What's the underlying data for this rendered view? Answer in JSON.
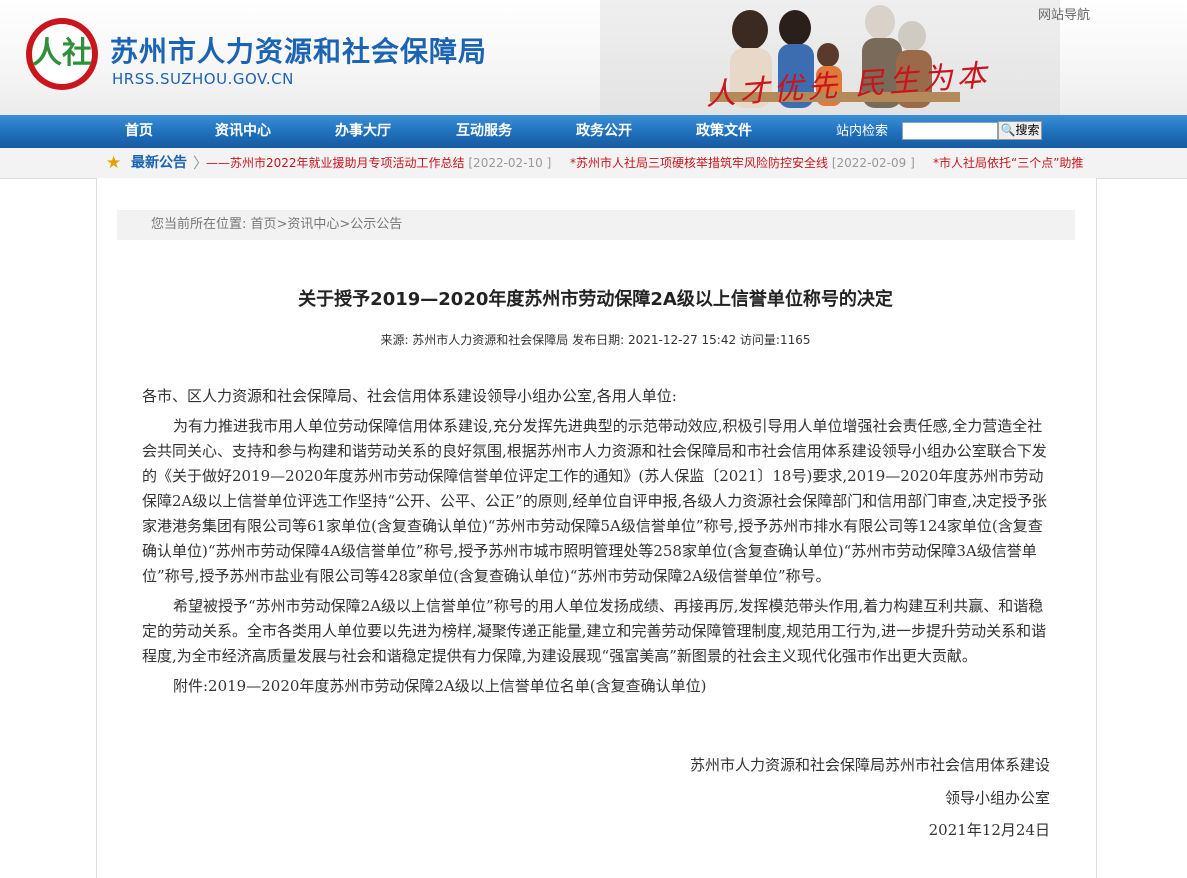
{
  "header": {
    "site_title": "苏州市人力资源和社会保障局",
    "site_url": "HRSS.SUZHOU.GOV.CN",
    "logo_text": "人社",
    "slogan": "人才优先 民生为本",
    "site_nav_link": "网站导航"
  },
  "nav": {
    "items": [
      "首页",
      "资讯中心",
      "办事大厅",
      "互动服务",
      "政务公开",
      "政策文件"
    ],
    "search_label": "站内检索",
    "search_value": "",
    "search_button": "🔍搜索"
  },
  "notice": {
    "title": "最新公告",
    "items": [
      {
        "text": "——苏州市2022年就业援助月专项活动工作总结",
        "date": "[2022-02-10 ]"
      },
      {
        "text": "*苏州市人社局三项硬核举措筑牢风险防控安全线",
        "date": "[2022-02-09 ]"
      },
      {
        "text": "*市人社局依托“三个点”助推",
        "date": ""
      }
    ]
  },
  "breadcrumb": "您当前所在位置:  首页>资讯中心>公示公告",
  "article": {
    "title": "关于授予2019—2020年度苏州市劳动保障2A级以上信誉单位称号的决定",
    "meta": "来源:  苏州市人力资源和社会保障局  发布日期: 2021-12-27 15:42  访问量:1165",
    "salutation": "各市、区人力资源和社会保障局、社会信用体系建设领导小组办公室,各用人单位:",
    "paragraphs": [
      "为有力推进我市用人单位劳动保障信用体系建设,充分发挥先进典型的示范带动效应,积极引导用人单位增强社会责任感,全力营造全社会共同关心、支持和参与构建和谐劳动关系的良好氛围,根据苏州市人力资源和社会保障局和市社会信用体系建设领导小组办公室联合下发的《关于做好2019—2020年度苏州市劳动保障信誉单位评定工作的通知》(苏人保监〔2021〕18号)要求,2019—2020年度苏州市劳动保障2A级以上信誉单位评选工作坚持“公开、公平、公正”的原则,经单位自评申报,各级人力资源社会保障部门和信用部门审查,决定授予张家港港务集团有限公司等61家单位(含复查确认单位)“苏州市劳动保障5A级信誉单位”称号,授予苏州市排水有限公司等124家单位(含复查确认单位)“苏州市劳动保障4A级信誉单位”称号,授予苏州市城市照明管理处等258家单位(含复查确认单位)“苏州市劳动保障3A级信誉单位”称号,授予苏州市盐业有限公司等428家单位(含复查确认单位)“苏州市劳动保障2A级信誉单位”称号。",
      "希望被授予“苏州市劳动保障2A级以上信誉单位”称号的用人单位发扬成绩、再接再厉,发挥模范带头作用,着力构建互利共赢、和谐稳定的劳动关系。全市各类用人单位要以先进为榜样,凝聚传递正能量,建立和完善劳动保障管理制度,规范用工行为,进一步提升劳动关系和谐程度,为全市经济高质量发展与社会和谐稳定提供有力保障,为建设展现“强富美高”新图景的社会主义现代化强市作出更大贡献。",
      "附件:2019—2020年度苏州市劳动保障2A级以上信誉单位名单(含复查确认单位)"
    ],
    "signature_1": "苏州市人力资源和社会保障局苏州市社会信用体系建设",
    "signature_2": "领导小组办公室",
    "signature_date": "2021年12月24日"
  },
  "colors": {
    "brand_blue": "#1b63b3",
    "nav_blue": "#1f6fbb",
    "accent_red": "#c9161d"
  },
  "icons": {
    "notice": "star-icon",
    "search": "magnifier-icon"
  }
}
